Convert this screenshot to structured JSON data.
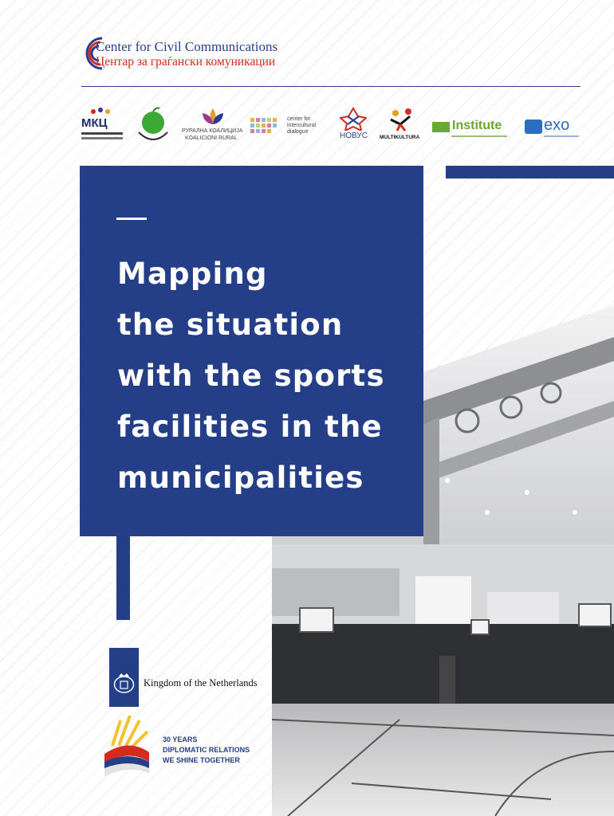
{
  "header": {
    "org_name_en": "Center for Civil Communications",
    "org_name_mk": "Центар за граѓански комуникации"
  },
  "partners": [
    {
      "name": "mkc-logo",
      "lines": [
        "МКЦ"
      ]
    },
    {
      "name": "green-apple-logo",
      "lines": []
    },
    {
      "name": "ruralna-koalicija-logo",
      "lines": [
        "РУРАЛНА КОАЛИЦИЈА",
        "KOALICIONI RURAL"
      ]
    },
    {
      "name": "center-intercultural-dialogue-logo",
      "lines": [
        "center for",
        "intercultural",
        "dialogue"
      ]
    },
    {
      "name": "novus-logo",
      "lines": [
        "НОВУС"
      ]
    },
    {
      "name": "multikultura-logo",
      "lines": [
        "MULTIKULTURA"
      ]
    },
    {
      "name": "zip-institute-logo",
      "lines": [
        "Institute"
      ]
    },
    {
      "name": "exo-logo",
      "lines": [
        "exo"
      ]
    }
  ],
  "title": {
    "lines": [
      "Mapping",
      "the situation",
      "with the sports",
      "facilities in the",
      "municipalities"
    ]
  },
  "sponsor": {
    "name": "Kingdom of the Netherlands"
  },
  "anniversary": {
    "lines": [
      "30 YEARS",
      "DIPLOMATIC RELATIONS",
      "WE SHINE TOGETHER"
    ]
  },
  "colors": {
    "brand_blue": "#243e88",
    "accent_red": "#d42a1f",
    "text_dark": "#111111"
  }
}
